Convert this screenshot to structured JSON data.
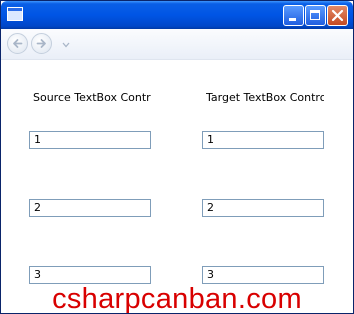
{
  "window": {
    "title": "",
    "caption_buttons": [
      "minimize",
      "maximize",
      "close"
    ]
  },
  "navigation": {
    "back_icon": "back-arrow-icon",
    "forward_icon": "forward-arrow-icon",
    "history_icon": "chevron-down-icon"
  },
  "source": {
    "label": "Source TextBox Controls",
    "boxes": [
      "1",
      "2",
      "3"
    ]
  },
  "target": {
    "label": "Target TextBox Controls",
    "boxes": [
      "1",
      "2",
      "3"
    ]
  },
  "watermark": "csharpcanban.com",
  "colors": {
    "titlebar": "#0055e5",
    "textbox_border": "#7f9db9",
    "watermark": "#d80000"
  }
}
